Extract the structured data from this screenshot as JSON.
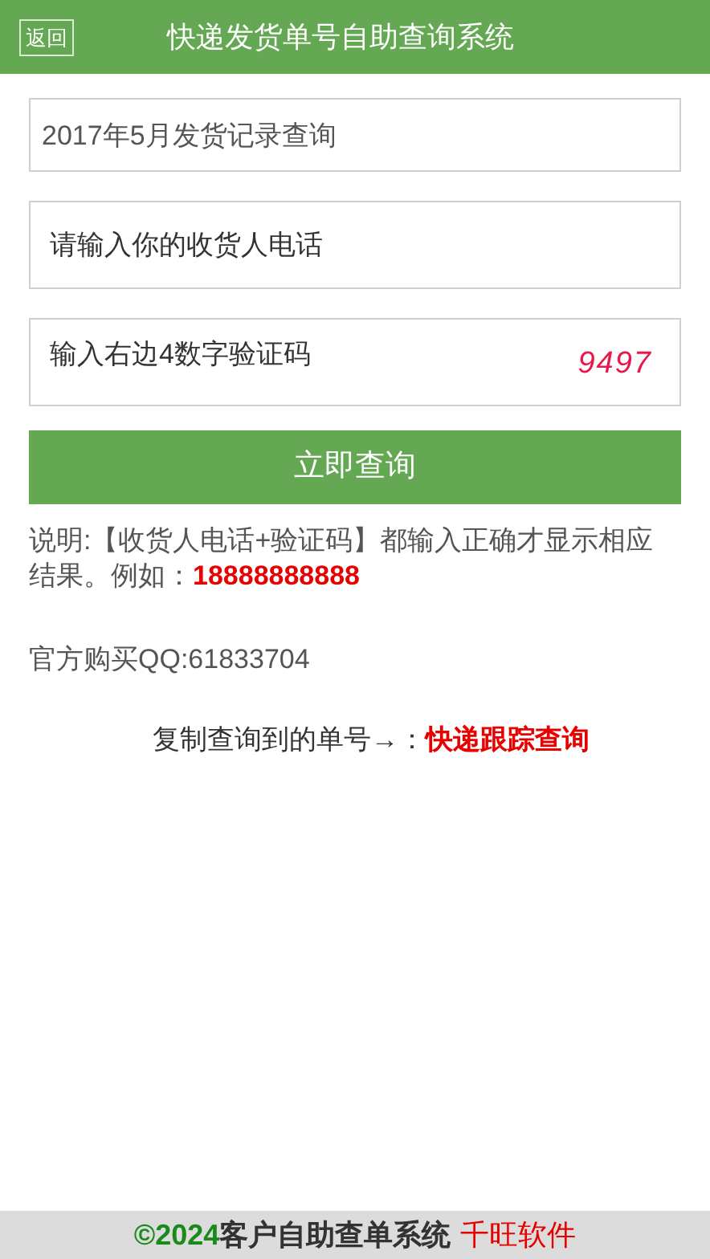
{
  "header": {
    "back_button": "返回",
    "title": "快递发货单号自助查询系统"
  },
  "form": {
    "month_select": {
      "value": "2017年5月发货记录查询"
    },
    "phone_field": {
      "placeholder": "请输入你的收货人电话"
    },
    "captcha_field": {
      "placeholder": "输入右边4数字验证码",
      "captcha": "9497"
    },
    "submit_button": "立即查询"
  },
  "note": "说明:【收货人电话+验证码】都输入正确才显示相应结果。例如：**18888888888**",
  "contact": "官方购买QQ:61833704",
  "tracking": {
    "label": "复制查询到的单号→：",
    "link": "快递跟踪查询"
  },
  "footer": {
    "year": "©2024",
    "system": "客户自助查单系统",
    "brand": "千旺软件"
  }
}
